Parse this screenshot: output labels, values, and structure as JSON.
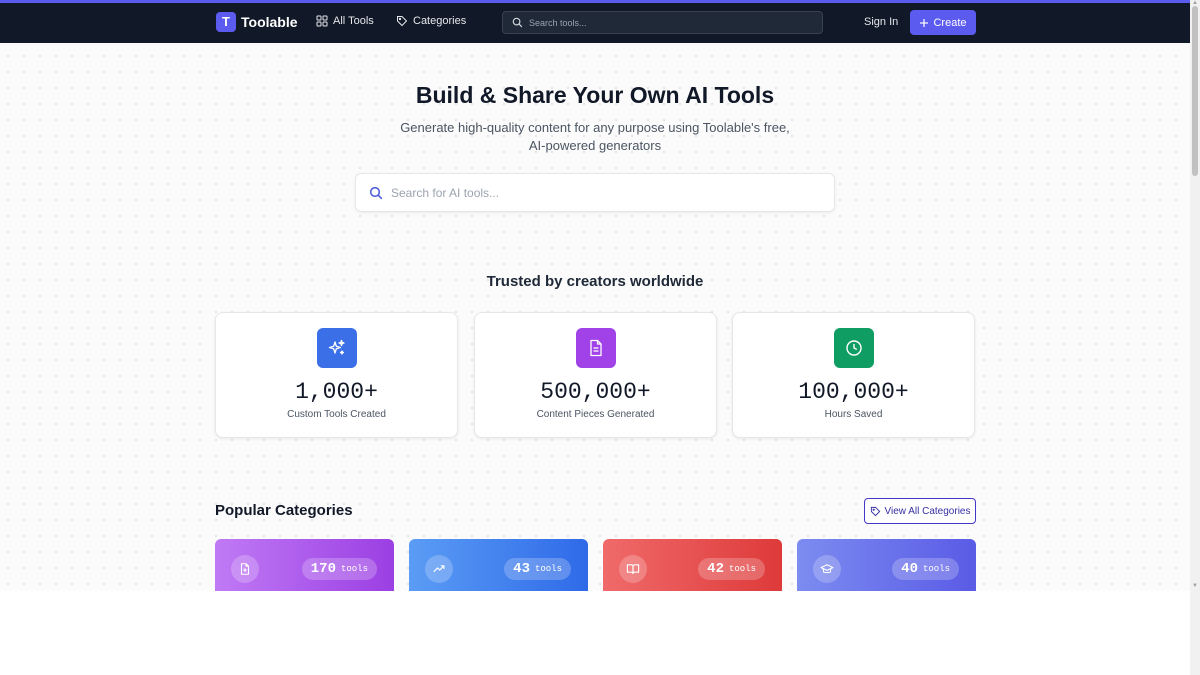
{
  "brand": {
    "logo_letter": "T",
    "name": "Toolable"
  },
  "nav": {
    "all_tools": "All Tools",
    "categories": "Categories",
    "search_placeholder": "Search tools...",
    "sign_in": "Sign In",
    "create": "Create"
  },
  "hero": {
    "title": "Build & Share Your Own AI Tools",
    "subtitle": "Generate high-quality content for any purpose using Toolable's free, AI-powered generators",
    "search_placeholder": "Search for AI tools..."
  },
  "stats": {
    "heading": "Trusted by creators worldwide",
    "items": [
      {
        "value": "1,000+",
        "label": "Custom Tools Created",
        "icon": "sparkles-icon",
        "color": "#3b6fe8"
      },
      {
        "value": "500,000+",
        "label": "Content Pieces Generated",
        "icon": "document-icon",
        "color": "#a142e8"
      },
      {
        "value": "100,000+",
        "label": "Hours Saved",
        "icon": "clock-icon",
        "color": "#0f9d63"
      }
    ]
  },
  "categories": {
    "heading": "Popular Categories",
    "view_all": "View All Categories",
    "items": [
      {
        "count": "170",
        "unit": "tools",
        "icon": "document-icon",
        "color_from": "#c07af5",
        "color_to": "#9b3fe3"
      },
      {
        "count": "43",
        "unit": "tools",
        "icon": "trending-up-icon",
        "color_from": "#5b9cf5",
        "color_to": "#2f6ae8"
      },
      {
        "count": "42",
        "unit": "tools",
        "icon": "book-open-icon",
        "color_from": "#f06a6a",
        "color_to": "#de3a3a"
      },
      {
        "count": "40",
        "unit": "tools",
        "icon": "graduation-cap-icon",
        "color_from": "#7c8cf0",
        "color_to": "#5a5be6"
      }
    ]
  }
}
